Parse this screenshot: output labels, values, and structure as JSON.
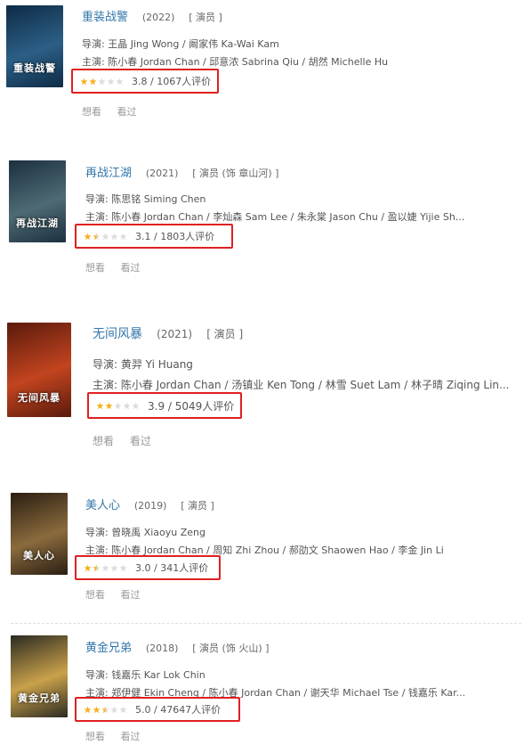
{
  "entries": [
    {
      "title": "重装战警",
      "year": "(2022)",
      "role": "[ 演员 ]",
      "director": "导演: 王晶 Jing Wong / 阚家伟 Ka-Wai Kam",
      "cast": "主演: 陈小春 Jordan Chan / 邱意浓 Sabrina Qiu / 胡然 Michelle Hu",
      "rating_value": 3.8,
      "rating_text": "3.8 / 1067人评价",
      "poster_text": "重装战警",
      "poster_colors": [
        "#0e2b45",
        "#2c5f86"
      ],
      "actions": [
        "想看",
        "看过"
      ]
    },
    {
      "title": "再战江湖",
      "year": "(2021)",
      "role": "[ 演员 (饰 章山河) ]",
      "director": "导演: 陈思铭 Siming Chen",
      "cast": "主演: 陈小春 Jordan Chan / 李灿森 Sam Lee / 朱永棠 Jason Chu / 盈以婕 Yijie Sh...",
      "rating_value": 3.1,
      "rating_text": "3.1 / 1803人评价",
      "poster_text": "再战江湖",
      "poster_colors": [
        "#1c3040",
        "#4e6a74"
      ],
      "actions": [
        "想看",
        "看过"
      ]
    },
    {
      "title": "无间风暴",
      "year": "(2021)",
      "role": "[ 演员 ]",
      "director": "导演: 黄羿 Yi Huang",
      "cast": "主演: 陈小春 Jordan Chan / 汤镇业 Ken Tong / 林雪 Suet Lam / 林子晴 Ziqing Lin...",
      "rating_value": 3.9,
      "rating_text": "3.9 / 5049人评价",
      "poster_text": "无间风暴",
      "poster_colors": [
        "#5a1a0d",
        "#c2441f"
      ],
      "actions": [
        "想看",
        "看过"
      ]
    },
    {
      "title": "美人心",
      "year": "(2019)",
      "role": "[ 演员 ]",
      "director": "导演: 曾晓禹 Xiaoyu Zeng",
      "cast": "主演: 陈小春 Jordan Chan / 周知 Zhi Zhou / 郝劭文 Shaowen Hao / 李金 Jin Li",
      "rating_value": 3.0,
      "rating_text": "3.0 / 341人评价",
      "poster_text": "美人心",
      "poster_colors": [
        "#2a1d12",
        "#8a6b3d"
      ],
      "actions": [
        "想看",
        "看过"
      ]
    },
    {
      "title": "黄金兄弟",
      "year": "(2018)",
      "role": "[ 演员 (饰 火山) ]",
      "director": "导演: 钱嘉乐 Kar Lok Chin",
      "cast": "主演: 郑伊健 Ekin Cheng / 陈小春 Jordan Chan / 谢天华 Michael Tse / 钱嘉乐 Kar...",
      "rating_value": 5.0,
      "rating_text": "5.0 / 47647人评价",
      "poster_text": "黄金兄弟",
      "poster_colors": [
        "#2b2a22",
        "#c9a14a"
      ],
      "actions": [
        "想看",
        "看过"
      ]
    }
  ]
}
